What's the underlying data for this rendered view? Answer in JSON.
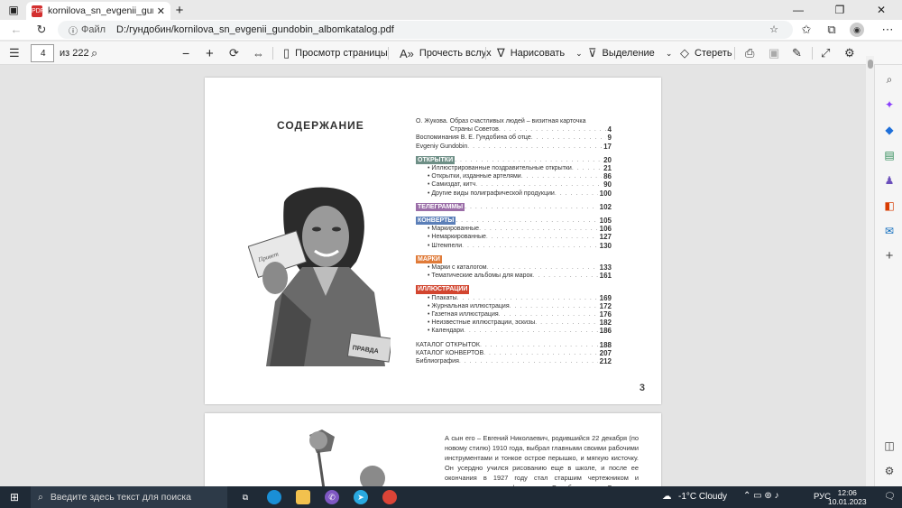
{
  "browser": {
    "tab_title": "kornilova_sn_evgenii_gundobin_",
    "address_label": "Файл",
    "address_value": "D:/гундобин/kornilova_sn_evgenii_gundobin_albomkatalog.pdf"
  },
  "pdf_toolbar": {
    "page_current": "4",
    "page_total": "из 222",
    "page_view": "Просмотр страницы",
    "read_aloud": "Прочесть вслух",
    "draw": "Нарисовать",
    "highlight": "Выделение",
    "erase": "Стереть"
  },
  "document": {
    "toc_title": "СОДЕРЖАНИЕ",
    "page_number": "3",
    "stamp_text": "ПРАВДА",
    "intro": [
      {
        "label": "О. Жукова. Образ счастливых людей – визитная карточка",
        "page": ""
      },
      {
        "label": "Страны Советов",
        "page": "4",
        "indent": true
      },
      {
        "label": "Воспоминания В. Е. Гундобина об отце",
        "page": "9"
      },
      {
        "label": "Evgeniy Gundobin",
        "page": "17"
      }
    ],
    "sections": [
      {
        "title": "ОТКРЫТКИ",
        "page": "20",
        "color": "#6e8f86",
        "items": [
          {
            "label": "Иллюстрированные поздравительные открытки",
            "page": "21"
          },
          {
            "label": "Открытки, изданные артелями",
            "page": "86"
          },
          {
            "label": "Самиздат, китч",
            "page": "90"
          },
          {
            "label": "Другие виды полиграфической продукции",
            "page": "100"
          }
        ]
      },
      {
        "title": "ТЕЛЕГРАММЫ",
        "page": "102",
        "color": "#9b6ea8",
        "items": []
      },
      {
        "title": "КОНВЕРТЫ",
        "page": "105",
        "color": "#5b7fb8",
        "items": [
          {
            "label": "Маркированные",
            "page": "106"
          },
          {
            "label": "Немаркированные",
            "page": "127"
          },
          {
            "label": "Штемпели",
            "page": "130"
          }
        ]
      },
      {
        "title": "МАРКИ",
        "page": "",
        "color": "#e07b39",
        "items": [
          {
            "label": "Марки с каталогом",
            "page": "133"
          },
          {
            "label": "Тематические альбомы для марок",
            "page": "161"
          }
        ]
      },
      {
        "title": "ИЛЛЮСТРАЦИИ",
        "page": "",
        "color": "#d2452f",
        "items": [
          {
            "label": "Плакаты",
            "page": "169"
          },
          {
            "label": "Журнальная иллюстрация",
            "page": "172"
          },
          {
            "label": "Газетная иллюстрация",
            "page": "176"
          },
          {
            "label": "Неизвестные иллюстрации, эскизы",
            "page": "182"
          },
          {
            "label": "Календари",
            "page": "186"
          }
        ]
      }
    ],
    "outro": [
      {
        "label": "КАТАЛОГ ОТКРЫТОК",
        "page": "188"
      },
      {
        "label": "КАТАЛОГ КОНВЕРТОВ",
        "page": "207"
      },
      {
        "label": "Библиография",
        "page": "212"
      }
    ],
    "next_page_text": "А сын его – Евгений Николаевич, родившийся 22 декабря (по новому стилю) 1910 года, выбрал главными своими рабочими инструментами и тонкое острое перышко, и мягкую кисточку. Он усердно учился рисованию еще в школе, и после ее окончания в 1927 году стал старшим чертежником и художником-картографом в Оренбургском Окружном земельном Управле-"
  },
  "taskbar": {
    "search_placeholder": "Введите здесь текст для поиска",
    "weather": "-1°C  Cloudy",
    "lang": "РУС",
    "time": "12:06",
    "date": "10.01.2023"
  }
}
